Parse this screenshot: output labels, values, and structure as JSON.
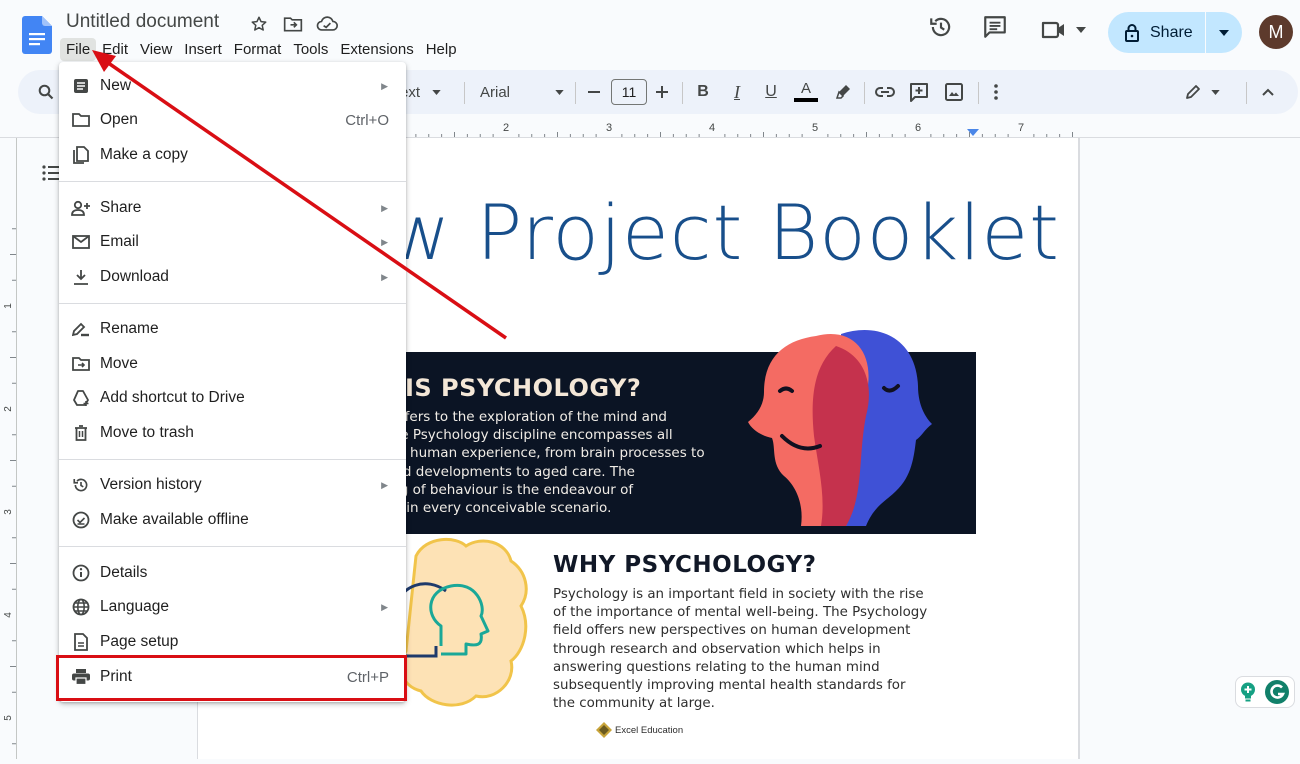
{
  "app": {
    "doc_title": "Untitled document",
    "menubar": [
      "File",
      "Edit",
      "View",
      "Insert",
      "Format",
      "Tools",
      "Extensions",
      "Help"
    ],
    "active_menu": "File",
    "share_label": "Share",
    "avatar_initial": "M",
    "accent_color": "#c2e7ff",
    "avatar_color": "#5d3a2c"
  },
  "toolbar": {
    "style_partial": "ext",
    "font": "Arial",
    "font_size": "11"
  },
  "ruler": {
    "h_labels": [
      "2",
      "3",
      "4",
      "5",
      "6",
      "7"
    ],
    "v_labels": [
      "1",
      "2",
      "3",
      "4",
      "5"
    ]
  },
  "file_menu": {
    "groups": [
      [
        {
          "label": "New",
          "icon": "doc-icon",
          "submenu": true
        },
        {
          "label": "Open",
          "icon": "folder-icon",
          "shortcut": "Ctrl+O"
        },
        {
          "label": "Make a copy",
          "icon": "copy-icon"
        }
      ],
      [
        {
          "label": "Share",
          "icon": "person-add-icon",
          "submenu": true
        },
        {
          "label": "Email",
          "icon": "mail-icon",
          "submenu": true
        },
        {
          "label": "Download",
          "icon": "download-icon",
          "submenu": true
        }
      ],
      [
        {
          "label": "Rename",
          "icon": "rename-icon"
        },
        {
          "label": "Move",
          "icon": "move-folder-icon"
        },
        {
          "label": "Add shortcut to Drive",
          "icon": "drive-shortcut-icon"
        },
        {
          "label": "Move to trash",
          "icon": "trash-icon"
        }
      ],
      [
        {
          "label": "Version history",
          "icon": "history-icon",
          "submenu": true
        },
        {
          "label": "Make available offline",
          "icon": "offline-icon"
        }
      ],
      [
        {
          "label": "Details",
          "icon": "info-icon"
        },
        {
          "label": "Language",
          "icon": "globe-icon",
          "submenu": true
        },
        {
          "label": "Page setup",
          "icon": "page-setup-icon"
        },
        {
          "label": "Print",
          "icon": "print-icon",
          "shortcut": "Ctrl+P",
          "highlighted": true
        }
      ]
    ]
  },
  "document": {
    "heading": "w Project Booklet",
    "section1_title": "AT IS PSYCHOLOGY?",
    "section1_text": "ogy refers to the exploration of the mind and\nur. The Psychology discipline encompasses all\n of the human experience, from brain processes to\nm child developments to aged care. The\nanding of behaviour is the endeavour of\nogists in every conceivable scenario.",
    "section2_title": "WHY PSYCHOLOGY?",
    "section2_text": "Psychology is an important field in society with the rise\nof the importance of mental well-being. The Psychology\nfield offers new perspectives on human development\nthrough research and observation which helps in\nanswering questions relating to the human mind\nsubsequently improving mental health standards for\nthe community at large.",
    "brand": "Excel Education"
  },
  "annotation": {
    "highlight_color": "#d90e14",
    "highlight_target": "Print"
  }
}
